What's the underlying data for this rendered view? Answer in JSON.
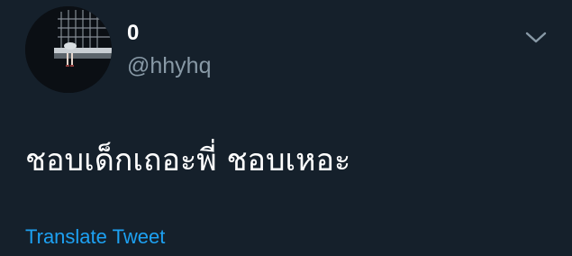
{
  "tweet": {
    "author": {
      "display_name": "0",
      "handle": "@hhyhq",
      "avatar_icon": "profile-photo"
    },
    "text": "ชอบเด็กเถอะพี่ ชอบเหอะ",
    "translate_label": "Translate Tweet",
    "menu_icon": "chevron-down-icon"
  },
  "colors": {
    "background": "#15202b",
    "primary_text": "#ffffff",
    "secondary_text": "#8899a6",
    "link": "#1da1f2"
  }
}
